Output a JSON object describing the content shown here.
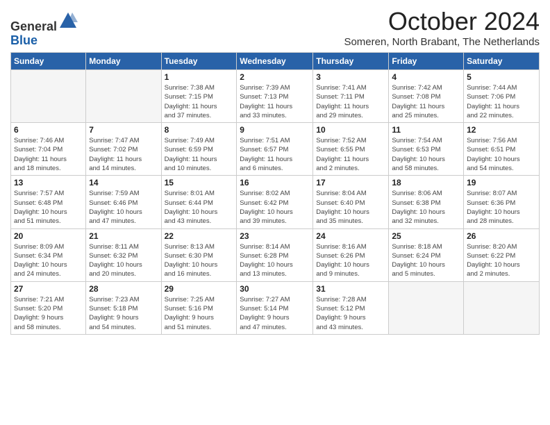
{
  "header": {
    "logo_line1": "General",
    "logo_line2": "Blue",
    "month_year": "October 2024",
    "location": "Someren, North Brabant, The Netherlands"
  },
  "weekdays": [
    "Sunday",
    "Monday",
    "Tuesday",
    "Wednesday",
    "Thursday",
    "Friday",
    "Saturday"
  ],
  "weeks": [
    [
      {
        "day": "",
        "detail": ""
      },
      {
        "day": "",
        "detail": ""
      },
      {
        "day": "1",
        "detail": "Sunrise: 7:38 AM\nSunset: 7:15 PM\nDaylight: 11 hours\nand 37 minutes."
      },
      {
        "day": "2",
        "detail": "Sunrise: 7:39 AM\nSunset: 7:13 PM\nDaylight: 11 hours\nand 33 minutes."
      },
      {
        "day": "3",
        "detail": "Sunrise: 7:41 AM\nSunset: 7:11 PM\nDaylight: 11 hours\nand 29 minutes."
      },
      {
        "day": "4",
        "detail": "Sunrise: 7:42 AM\nSunset: 7:08 PM\nDaylight: 11 hours\nand 25 minutes."
      },
      {
        "day": "5",
        "detail": "Sunrise: 7:44 AM\nSunset: 7:06 PM\nDaylight: 11 hours\nand 22 minutes."
      }
    ],
    [
      {
        "day": "6",
        "detail": "Sunrise: 7:46 AM\nSunset: 7:04 PM\nDaylight: 11 hours\nand 18 minutes."
      },
      {
        "day": "7",
        "detail": "Sunrise: 7:47 AM\nSunset: 7:02 PM\nDaylight: 11 hours\nand 14 minutes."
      },
      {
        "day": "8",
        "detail": "Sunrise: 7:49 AM\nSunset: 6:59 PM\nDaylight: 11 hours\nand 10 minutes."
      },
      {
        "day": "9",
        "detail": "Sunrise: 7:51 AM\nSunset: 6:57 PM\nDaylight: 11 hours\nand 6 minutes."
      },
      {
        "day": "10",
        "detail": "Sunrise: 7:52 AM\nSunset: 6:55 PM\nDaylight: 11 hours\nand 2 minutes."
      },
      {
        "day": "11",
        "detail": "Sunrise: 7:54 AM\nSunset: 6:53 PM\nDaylight: 10 hours\nand 58 minutes."
      },
      {
        "day": "12",
        "detail": "Sunrise: 7:56 AM\nSunset: 6:51 PM\nDaylight: 10 hours\nand 54 minutes."
      }
    ],
    [
      {
        "day": "13",
        "detail": "Sunrise: 7:57 AM\nSunset: 6:48 PM\nDaylight: 10 hours\nand 51 minutes."
      },
      {
        "day": "14",
        "detail": "Sunrise: 7:59 AM\nSunset: 6:46 PM\nDaylight: 10 hours\nand 47 minutes."
      },
      {
        "day": "15",
        "detail": "Sunrise: 8:01 AM\nSunset: 6:44 PM\nDaylight: 10 hours\nand 43 minutes."
      },
      {
        "day": "16",
        "detail": "Sunrise: 8:02 AM\nSunset: 6:42 PM\nDaylight: 10 hours\nand 39 minutes."
      },
      {
        "day": "17",
        "detail": "Sunrise: 8:04 AM\nSunset: 6:40 PM\nDaylight: 10 hours\nand 35 minutes."
      },
      {
        "day": "18",
        "detail": "Sunrise: 8:06 AM\nSunset: 6:38 PM\nDaylight: 10 hours\nand 32 minutes."
      },
      {
        "day": "19",
        "detail": "Sunrise: 8:07 AM\nSunset: 6:36 PM\nDaylight: 10 hours\nand 28 minutes."
      }
    ],
    [
      {
        "day": "20",
        "detail": "Sunrise: 8:09 AM\nSunset: 6:34 PM\nDaylight: 10 hours\nand 24 minutes."
      },
      {
        "day": "21",
        "detail": "Sunrise: 8:11 AM\nSunset: 6:32 PM\nDaylight: 10 hours\nand 20 minutes."
      },
      {
        "day": "22",
        "detail": "Sunrise: 8:13 AM\nSunset: 6:30 PM\nDaylight: 10 hours\nand 16 minutes."
      },
      {
        "day": "23",
        "detail": "Sunrise: 8:14 AM\nSunset: 6:28 PM\nDaylight: 10 hours\nand 13 minutes."
      },
      {
        "day": "24",
        "detail": "Sunrise: 8:16 AM\nSunset: 6:26 PM\nDaylight: 10 hours\nand 9 minutes."
      },
      {
        "day": "25",
        "detail": "Sunrise: 8:18 AM\nSunset: 6:24 PM\nDaylight: 10 hours\nand 5 minutes."
      },
      {
        "day": "26",
        "detail": "Sunrise: 8:20 AM\nSunset: 6:22 PM\nDaylight: 10 hours\nand 2 minutes."
      }
    ],
    [
      {
        "day": "27",
        "detail": "Sunrise: 7:21 AM\nSunset: 5:20 PM\nDaylight: 9 hours\nand 58 minutes."
      },
      {
        "day": "28",
        "detail": "Sunrise: 7:23 AM\nSunset: 5:18 PM\nDaylight: 9 hours\nand 54 minutes."
      },
      {
        "day": "29",
        "detail": "Sunrise: 7:25 AM\nSunset: 5:16 PM\nDaylight: 9 hours\nand 51 minutes."
      },
      {
        "day": "30",
        "detail": "Sunrise: 7:27 AM\nSunset: 5:14 PM\nDaylight: 9 hours\nand 47 minutes."
      },
      {
        "day": "31",
        "detail": "Sunrise: 7:28 AM\nSunset: 5:12 PM\nDaylight: 9 hours\nand 43 minutes."
      },
      {
        "day": "",
        "detail": ""
      },
      {
        "day": "",
        "detail": ""
      }
    ]
  ]
}
